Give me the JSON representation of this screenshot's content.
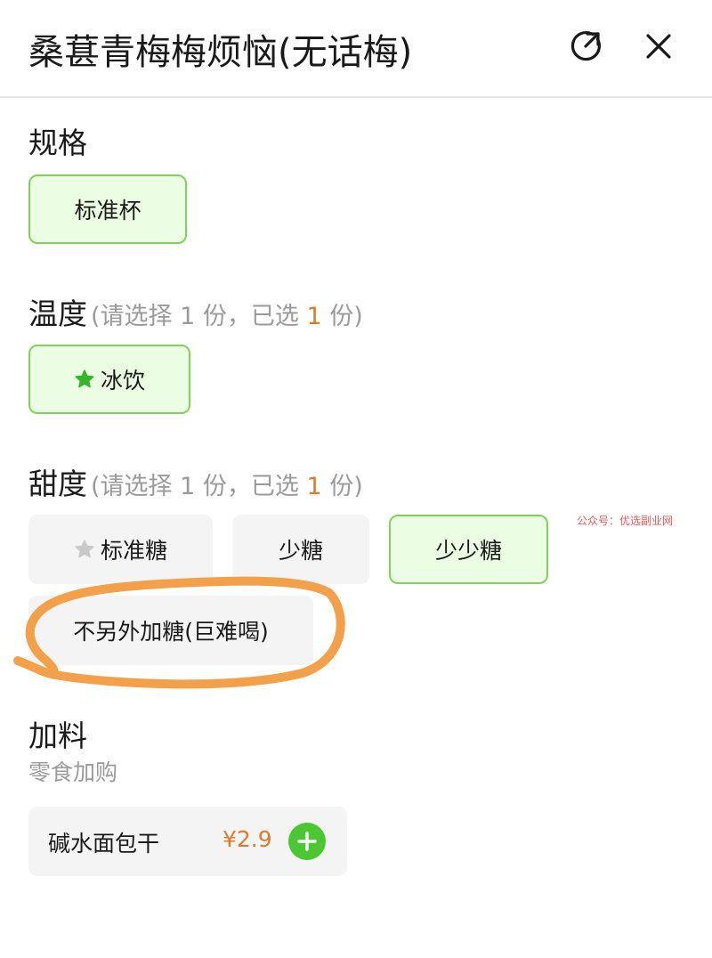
{
  "header": {
    "title": "桑葚青梅梅烦恼(无话梅)",
    "share_icon": "share-icon",
    "close_icon": "close-icon"
  },
  "sections": {
    "size": {
      "title": "规格",
      "options": [
        {
          "label": "标准杯",
          "selected": true
        }
      ]
    },
    "temperature": {
      "title": "温度",
      "hint_prefix": "(请选择 1 份，已选 ",
      "hint_count": "1",
      "hint_suffix": " 份)",
      "options": [
        {
          "label": "冰饮",
          "selected": true,
          "icon": "star-icon"
        }
      ]
    },
    "sweetness": {
      "title": "甜度",
      "hint_prefix": "(请选择 1 份，已选 ",
      "hint_count": "1",
      "hint_suffix": " 份)",
      "options": [
        {
          "label": "标准糖",
          "selected": false,
          "icon": "star-icon"
        },
        {
          "label": "少糖",
          "selected": false
        },
        {
          "label": "少少糖",
          "selected": true
        },
        {
          "label": "不另外加糖(巨难喝)",
          "selected": false
        }
      ]
    },
    "toppings": {
      "title": "加料",
      "subtitle": "零食加购",
      "items": [
        {
          "name": "碱水面包干",
          "price": "¥2.9"
        }
      ]
    }
  },
  "watermark": "公众号：优选副业网",
  "colors": {
    "selected_bg": "#ebfde3",
    "selected_border": "#7fd35a",
    "accent_green": "#4cc733",
    "price_orange": "#e07a2e",
    "annotation_orange": "#f3a04a"
  }
}
